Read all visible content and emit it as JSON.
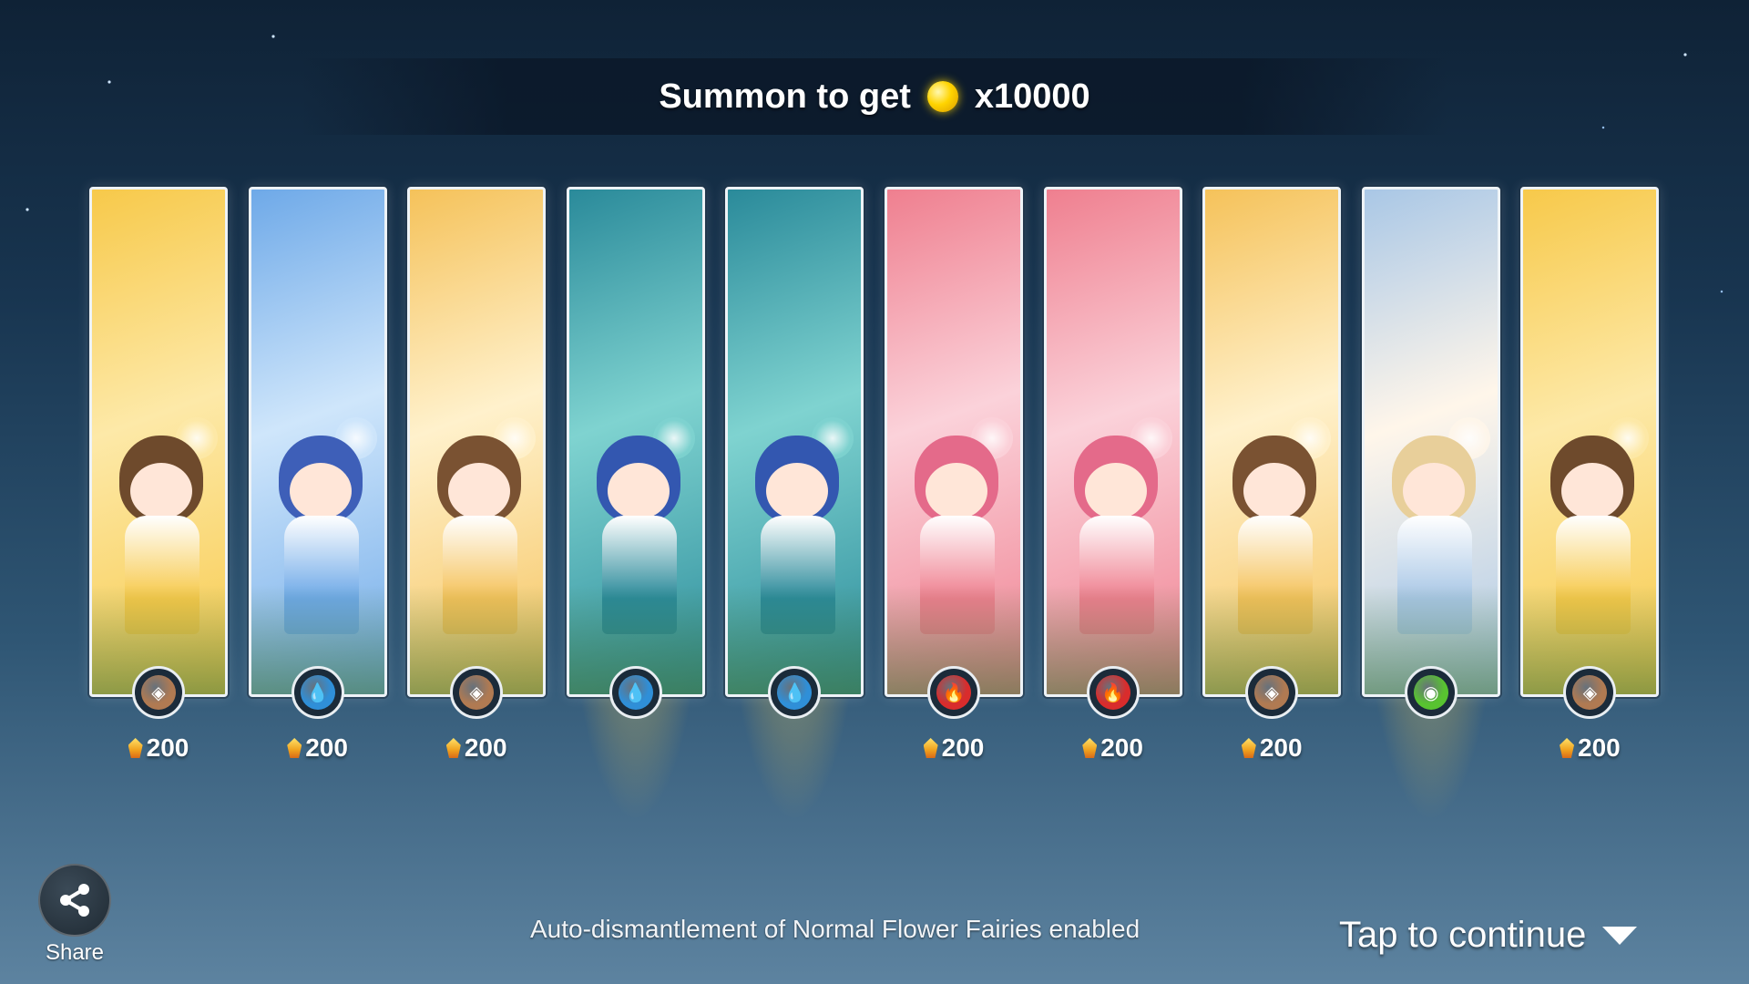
{
  "banner": {
    "prefix": "Summon to get",
    "amount": "x10000",
    "icon": "gold-coin-icon"
  },
  "cards": [
    {
      "element": "earth",
      "element_icon": "earth-element-icon",
      "price": "200",
      "rarity": "normal",
      "theme": [
        "#f7c94a",
        "#fde9a8",
        "#6e4a2c"
      ]
    },
    {
      "element": "water",
      "element_icon": "water-element-icon",
      "price": "200",
      "rarity": "normal",
      "theme": [
        "#6ea9e8",
        "#cfe6fb",
        "#3e5fb8"
      ]
    },
    {
      "element": "earth",
      "element_icon": "earth-element-icon",
      "price": "200",
      "rarity": "normal",
      "theme": [
        "#f5c25a",
        "#fff1cc",
        "#7a5232"
      ]
    },
    {
      "element": "water",
      "element_icon": "water-element-icon",
      "price": "",
      "rarity": "rare",
      "theme": [
        "#2a8a9a",
        "#7fd3d0",
        "#3357b0"
      ]
    },
    {
      "element": "water",
      "element_icon": "water-element-icon",
      "price": "",
      "rarity": "rare",
      "theme": [
        "#2a8a9a",
        "#7fd3d0",
        "#3357b0"
      ]
    },
    {
      "element": "fire",
      "element_icon": "fire-element-icon",
      "price": "200",
      "rarity": "normal",
      "theme": [
        "#ef7f8f",
        "#fbd2da",
        "#e46a8a"
      ]
    },
    {
      "element": "fire",
      "element_icon": "fire-element-icon",
      "price": "200",
      "rarity": "normal",
      "theme": [
        "#ef7f8f",
        "#fbd2da",
        "#e46a8a"
      ]
    },
    {
      "element": "earth",
      "element_icon": "earth-element-icon",
      "price": "200",
      "rarity": "normal",
      "theme": [
        "#f5c25a",
        "#fff1cc",
        "#7a5232"
      ]
    },
    {
      "element": "wind",
      "element_icon": "wind-element-icon",
      "price": "",
      "rarity": "rare",
      "theme": [
        "#a9c7e6",
        "#fff6ea",
        "#e8cf9a"
      ]
    },
    {
      "element": "earth",
      "element_icon": "earth-element-icon",
      "price": "200",
      "rarity": "normal",
      "theme": [
        "#f7c94a",
        "#fde9a8",
        "#6e4a2c"
      ]
    }
  ],
  "colors": {
    "earth": "#b07a52",
    "water": "#2f8fd8",
    "fire": "#d92c2c",
    "wind": "#58c330"
  },
  "share": {
    "label": "Share",
    "icon": "share-icon"
  },
  "footer": {
    "note": "Auto-dismantlement of Normal Flower Fairies enabled",
    "tap": "Tap to continue",
    "arrow_icon": "caret-down-icon"
  }
}
